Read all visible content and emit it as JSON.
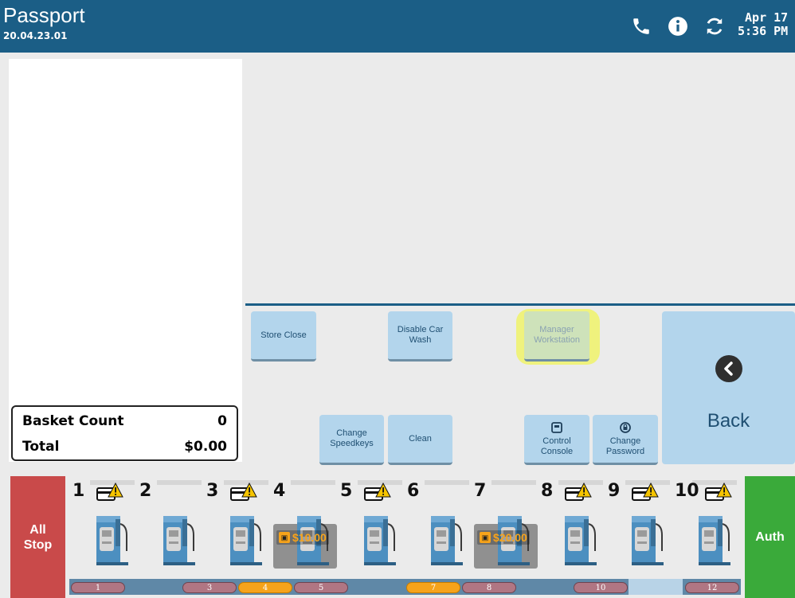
{
  "header": {
    "title": "Passport",
    "version": "20.04.23.01",
    "date": "Apr 17",
    "time": "5:36 PM"
  },
  "colors": {
    "header": "#1b5e86",
    "button": "#b3d5ec",
    "all_stop": "#c94a4a",
    "auth": "#3aaa3a",
    "highlight": "#f0f36a",
    "prepay": "#f6a31b"
  },
  "totals": {
    "basket_label": "Basket Count",
    "basket_value": "0",
    "total_label": "Total",
    "total_value": "$0.00"
  },
  "buttons": {
    "store_close": "Store Close",
    "disable_wash_1": "Disable Car",
    "disable_wash_2": "Wash",
    "manager_1": "Manager",
    "manager_2": "Workstation",
    "speedkeys_1": "Change",
    "speedkeys_2": "Speedkeys",
    "clean": "Clean",
    "console_1": "Control",
    "console_2": "Console",
    "password_1": "Change",
    "password_2": "Password",
    "back": "Back"
  },
  "fuel": {
    "all_stop_1": "All",
    "all_stop_2": "Stop",
    "auth": "Auth",
    "pumps": [
      {
        "number": "1",
        "warning": true,
        "amount": ""
      },
      {
        "number": "2",
        "warning": false,
        "amount": ""
      },
      {
        "number": "3",
        "warning": true,
        "amount": ""
      },
      {
        "number": "4",
        "warning": false,
        "amount": "$10.00"
      },
      {
        "number": "5",
        "warning": true,
        "amount": ""
      },
      {
        "number": "6",
        "warning": false,
        "amount": ""
      },
      {
        "number": "7",
        "warning": false,
        "amount": "$20.00"
      },
      {
        "number": "8",
        "warning": true,
        "amount": ""
      },
      {
        "number": "9",
        "warning": true,
        "amount": ""
      },
      {
        "number": "10",
        "warning": true,
        "amount": ""
      }
    ],
    "status_chips": [
      {
        "label": "1",
        "color": "red"
      },
      {
        "label": "3",
        "color": "red"
      },
      {
        "label": "4",
        "color": "orange"
      },
      {
        "label": "5",
        "color": "red"
      },
      {
        "label": "7",
        "color": "orange"
      },
      {
        "label": "8",
        "color": "red"
      },
      {
        "label": "10",
        "color": "red"
      },
      {
        "label": "12",
        "color": "red"
      }
    ]
  }
}
